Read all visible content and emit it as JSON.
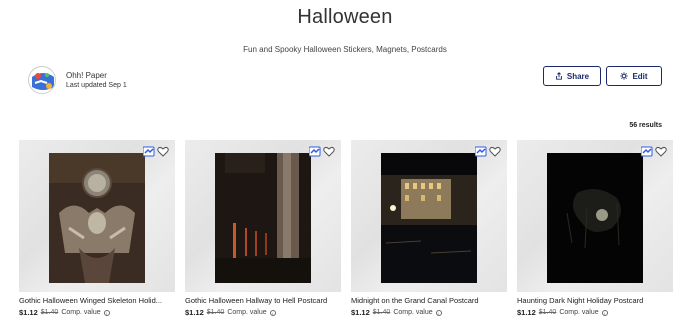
{
  "collection": {
    "title": "Halloween",
    "subtitle": "Fun and Spooky Halloween Stickers, Magnets, Postcards"
  },
  "owner": {
    "name": "Ohh! Paper",
    "updated": "Last updated Sep 1"
  },
  "actions": {
    "share_label": "Share",
    "edit_label": "Edit",
    "share_icon": "share-icon",
    "edit_icon": "gear-icon"
  },
  "results_label": "56 results",
  "products": [
    {
      "title": "Gothic Halloween Winged Skeleton Holid...",
      "price": "$1.12",
      "old_price": "$1.40",
      "comp_label": "Comp. value"
    },
    {
      "title": "Gothic Halloween Hallway to Hell Postcard",
      "price": "$1.12",
      "old_price": "$1.40",
      "comp_label": "Comp. value"
    },
    {
      "title": "Midnight on the Grand Canal Postcard",
      "price": "$1.12",
      "old_price": "$1.40",
      "comp_label": "Comp. value"
    },
    {
      "title": "Haunting Dark Night Holiday Postcard",
      "price": "$1.12",
      "old_price": "$1.40",
      "comp_label": "Comp. value"
    }
  ],
  "colors": {
    "accent": "#1a2a6c",
    "collection_badge": "#2d5be3"
  }
}
